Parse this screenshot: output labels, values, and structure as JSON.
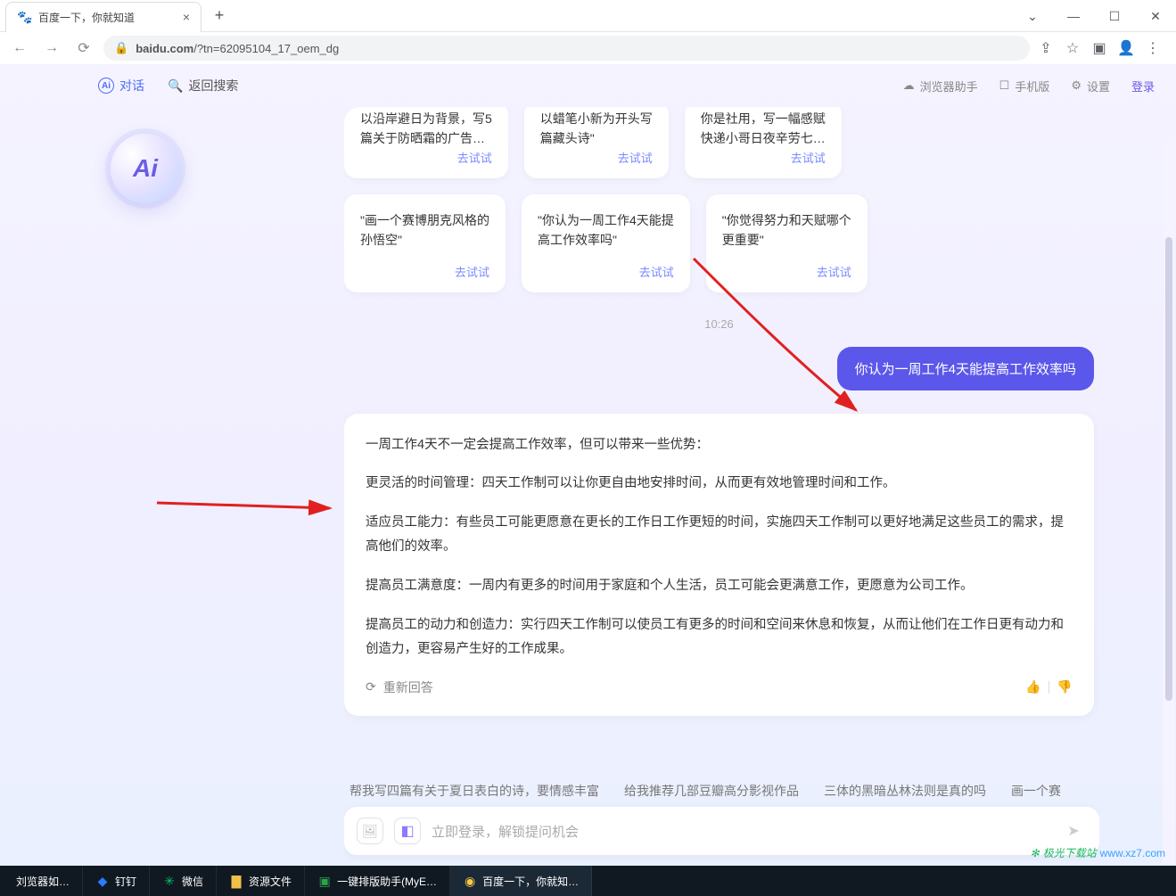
{
  "window": {
    "tab_title": "百度一下，你就知道"
  },
  "browser": {
    "url_display": "baidu.com/?tn=62095104_17_oem_dg",
    "url_gray_prefix": "baidu.com"
  },
  "topnav": {
    "chat": "对话",
    "back_search": "返回搜索",
    "assistant": "浏览器助手",
    "mobile": "手机版",
    "settings": "设置",
    "login": "登录"
  },
  "cards_top": [
    {
      "line1": "以沿岸避日为背景，写5",
      "line2": "篇关于防晒霜的广告…",
      "try": "去试试"
    },
    {
      "line1": "以蜡笔小新为开头写",
      "line2": "篇藏头诗\"",
      "try": "去试试"
    },
    {
      "line1": "你是社用，写一幅感赋",
      "line2": "快递小哥日夜辛劳七…",
      "try": "去试试"
    }
  ],
  "cards_bottom": [
    {
      "line1": "\"画一个赛博朋克风格的",
      "line2": "孙悟空\"",
      "try": "去试试"
    },
    {
      "line1": "\"你认为一周工作4天能提",
      "line2": "高工作效率吗\"",
      "try": "去试试"
    },
    {
      "line1": "\"你觉得努力和天赋哪个",
      "line2": "更重要\"",
      "try": "去试试"
    }
  ],
  "conversation": {
    "time": "10:26",
    "user_msg": "你认为一周工作4天能提高工作效率吗",
    "ai_paragraphs": [
      "一周工作4天不一定会提高工作效率，但可以带来一些优势：",
      "更灵活的时间管理：四天工作制可以让你更自由地安排时间，从而更有效地管理时间和工作。",
      "适应员工能力：有些员工可能更愿意在更长的工作日工作更短的时间，实施四天工作制可以更好地满足这些员工的需求，提高他们的效率。",
      "提高员工满意度：一周内有更多的时间用于家庭和个人生活，员工可能会更满意工作，更愿意为公司工作。",
      "提高员工的动力和创造力：实行四天工作制可以使员工有更多的时间和空间来休息和恢复，从而让他们在工作日更有动力和创造力，更容易产生好的工作成果。"
    ],
    "regen": "重新回答"
  },
  "chips": [
    "帮我写四篇有关于夏日表白的诗，要情感丰富",
    "给我推荐几部豆瓣高分影视作品",
    "三体的黑暗丛林法则是真的吗",
    "画一个赛"
  ],
  "inputbar": {
    "placeholder": "立即登录，解锁提问机会"
  },
  "taskbar": {
    "items": [
      {
        "label": "刘览器如…",
        "icon": ""
      },
      {
        "label": "钉钉",
        "icon": "🔵",
        "color": "#2a7bff"
      },
      {
        "label": "微信",
        "icon": "💬",
        "color": "#07c160"
      },
      {
        "label": "资源文件",
        "icon": "📁",
        "color": "#f0c04a"
      },
      {
        "label": "一键排版助手(MyE…",
        "icon": "🟩",
        "color": "#2aa44a"
      },
      {
        "label": "百度一下，你就知…",
        "icon": "🟡",
        "active": true
      }
    ]
  },
  "watermark": {
    "site": "极光下载站",
    "domain": "www.xz7.com"
  }
}
